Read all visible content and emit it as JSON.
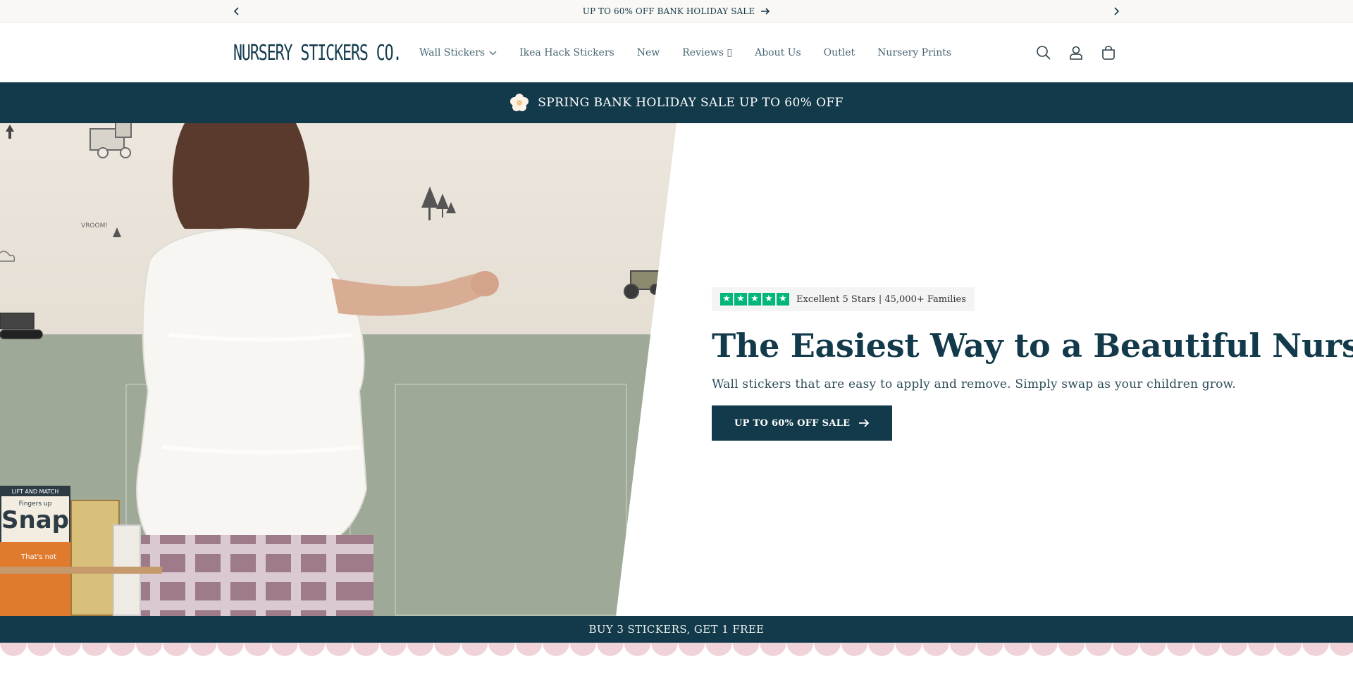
{
  "announcement": {
    "text": "UP TO 60% OFF BANK HOLIDAY SALE",
    "prev_icon": "chevron-left-icon",
    "next_icon": "chevron-right-icon",
    "arrow_icon": "arrow-right-icon"
  },
  "header": {
    "logo": "NURSERY STICKERS CO.",
    "nav": [
      {
        "label": "Wall Stickers",
        "has_dropdown": true
      },
      {
        "label": "Ikea Hack Stickers"
      },
      {
        "label": "New"
      },
      {
        "label": "Reviews ▯"
      },
      {
        "label": "About Us"
      },
      {
        "label": "Outlet"
      },
      {
        "label": "Nursery Prints"
      }
    ],
    "icons": [
      "search-icon",
      "account-icon",
      "cart-icon"
    ]
  },
  "promo_banner": {
    "text": "SPRING BANK HOLIDAY SALE UP TO 60% OFF",
    "icon": "flower-icon"
  },
  "hero": {
    "trust_text": "Excellent 5 Stars | 45,000+ Families",
    "rating_stars": 5,
    "headline": "The Easiest Way to a Beautiful Nursery",
    "subline": "Wall stickers that are easy to apply and remove. Simply swap as your children grow.",
    "cta_label": "UP TO 60% OFF SALE",
    "wall_text": "VROOM!",
    "book_title": "Snap!",
    "book_top": "LIFT AND MATCH",
    "book_sub": "Fingers up",
    "book2_text": "That's not"
  },
  "offer_strip": {
    "text": "BUY 3 STICKERS, GET 1 FREE"
  },
  "colors": {
    "brand_navy": "#133a4a",
    "trustpilot_green": "#00b67a",
    "scallop_pink": "#f0d3d9",
    "announce_bg": "#faf8f5"
  }
}
